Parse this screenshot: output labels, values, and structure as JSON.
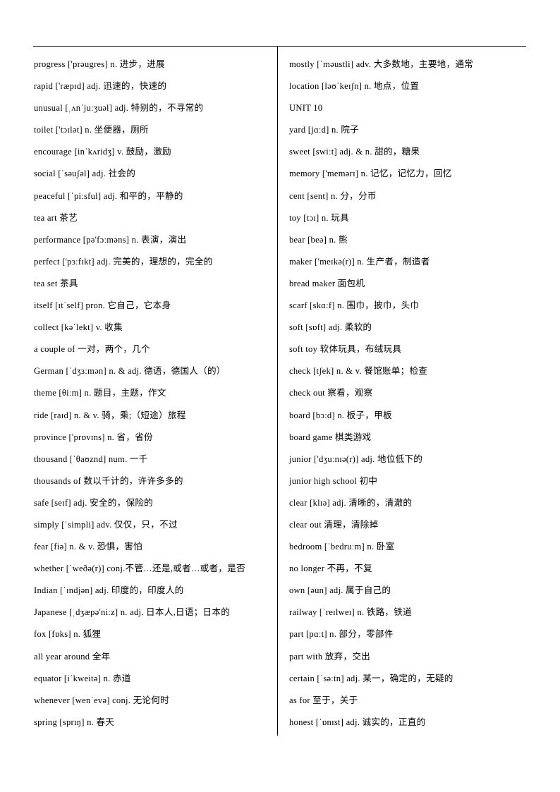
{
  "document": {
    "title": "English Vocabulary List",
    "rule_color": "#000000",
    "text_color": "#000000",
    "background_color": "#ffffff"
  },
  "columns": {
    "left": {
      "entries": [
        "progress ['prəugres] n.  进步，进展",
        "rapid ['ræpɪd] adj.  迅速的，快速的",
        "unusual [ˌʌnˈjuːʒuəl] adj.  特别的，不寻常的",
        "toilet ['tɔɪlət] n.  坐便器，厕所",
        "encourage [inˈkʌridʒ] v.  鼓励，激励",
        "social [ˈsəuʃəl] adj.  社会的",
        "peaceful [ˈpiːsful] adj.  和平的，平静的",
        "tea art  茶艺",
        "performance [pə'fɔːməns] n.  表演，演出",
        "perfect ['pɜːfɪkt] adj.  完美的，理想的，完全的",
        "tea set  茶具",
        "itself [ɪtˈself] pron.  它自己，它本身",
        "collect [kəˈlekt] v.  收集",
        "a couple of  一对，两个，几个",
        "German [ˈdʒɜːmən] n. & adj.  德语，德国人（的）",
        "theme [θiːm] n.  题目，主题，作文",
        "ride [raɪd] n. & v.  骑，乘;（短途）旅程",
        "province ['prɒvɪns] n.  省，省份",
        "thousand [ˈθaʊznd] num.  一千",
        "thousands of  数以千计的，许许多多的",
        "safe [seɪf] adj.  安全的，保险的",
        "simply [ˈsimpli] adv.  仅仅，只，不过",
        "fear [fiə] n. & v.  恐惧，害怕",
        "whether [ˈweðə(r)] conj.不管…还是,或者…或者，是否",
        "Indian [ˈɪndjən] adj.  印度的，印度人的",
        "Japanese [ˌdʒæpə'niːz] n. adj.  日本人,日语；日本的",
        "fox [fɒks] n.  狐狸",
        "all year around  全年",
        "equator [iˈkweitə] n.  赤道",
        "whenever [wenˈevə] conj.  无论何时",
        "spring [sprɪŋ] n.  春天"
      ]
    },
    "right": {
      "entries": [
        "mostly [ˈməustli] adv.  大多数地，主要地，通常",
        "location [ləʊˈkeɪʃn] n.  地点，位置",
        "UNIT 10",
        "yard [jɑːd] n.  院子",
        "sweet [swiːt] adj. & n.  甜的，糖果",
        "memory ['memərɪ] n.  记忆，记忆力，回忆",
        "cent [sent] n.  分，分币",
        "toy [tɔɪ] n.  玩具",
        "bear [beə] n.  熊",
        "maker ['meɪkə(r)] n.  生产者，制造者",
        "bread maker  面包机",
        "scarf [skɑːf] n.  围巾，披巾，头巾",
        "soft [sɒft] adj.  柔软的",
        "soft toy  软体玩具，布绒玩具",
        "check [tʃek] n. & v.  餐馆账单；检查",
        "check out  察看，观察",
        "board [bɔːd] n.  板子，甲板",
        "board game  棋类游戏",
        "junior ['dʒuːnɪə(r)] adj.  地位低下的",
        "junior high school  初中",
        "clear [klɪə] adj.  清晰的，清澈的",
        "clear out  清理，清除掉",
        "bedroom [ˈbedruːm] n.  卧室",
        "no longer  不再，不复",
        "own [əun] adj.  属于自己的",
        "railway [ˈreɪlweɪ] n.  铁路，铁道",
        "part [pɑːt] n.  部分，零部件",
        "part with  放弃，交出",
        "certain [ˈsəːtn] adj.  某一，确定的，无疑的",
        "as for  至于，关于",
        "honest [ˈɒnɪst] adj.  诚实的，正直的"
      ]
    }
  }
}
